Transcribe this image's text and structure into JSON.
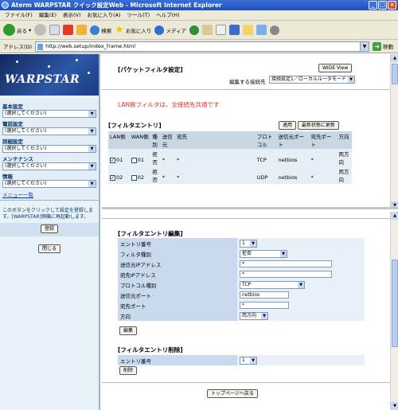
{
  "window": {
    "title": "Aterm WARPSTAR クイック設定Web - Microsoft Internet Explorer",
    "minimize": "_",
    "maximize": "□",
    "close": "×"
  },
  "menubar": [
    "ファイル(F)",
    "編集(E)",
    "表示(V)",
    "お気に入り(A)",
    "ツール(T)",
    "ヘルプ(H)"
  ],
  "toolbar": {
    "back": "戻る",
    "search": "検索",
    "favorites": "お気に入り",
    "media": "メディア"
  },
  "address": {
    "label": "アドレス(D)",
    "url": "http://web.setup/index_frame.html",
    "go": "移動"
  },
  "left": {
    "logo": "WARPSTAR",
    "sections": [
      {
        "label": "基本設定",
        "value": "(選択してください)"
      },
      {
        "label": "電話設定",
        "value": "(選択してください)"
      },
      {
        "label": "詳細設定",
        "value": "(選択してください)"
      },
      {
        "label": "メンテナンス",
        "value": "(選択してください)"
      },
      {
        "label": "情報",
        "value": "(選択してください)"
      }
    ],
    "menu_list": "メニュー一覧",
    "note": "このボタンをクリックして設定を登録します。[WARPSTAR]側機に再起動します。",
    "register": "登録",
    "close": "閉じる"
  },
  "upper": {
    "title": "[パケットフィルタ設定]",
    "wide_view": "WIDE View",
    "connection_label": "編集する接続先",
    "connection_value": "接続設定1／ローカルルータモード",
    "notice": "LAN側フィルタは、全接続先共通です",
    "entry_title": "[フィルタエントリ]",
    "apply": "適用",
    "refresh": "最新状態に更新",
    "columns": [
      "LAN側",
      "WAN側",
      "種別",
      "送信元",
      "宛先",
      "プロトコル",
      "送信元ポート",
      "宛先ポート",
      "方向"
    ],
    "rows": [
      {
        "lan": "01",
        "lan_checked": true,
        "wan": "01",
        "wan_checked": false,
        "type": "拒否",
        "src": "*",
        "dst": "*",
        "proto": "TCP",
        "sport": "netbios",
        "dport": "*",
        "dir": "両方向"
      },
      {
        "lan": "02",
        "lan_checked": true,
        "wan": "02",
        "wan_checked": false,
        "type": "拒否",
        "src": "*",
        "dst": "*",
        "proto": "UDP",
        "sport": "netbios",
        "dport": "*",
        "dir": "両方向"
      }
    ]
  },
  "lower": {
    "edit_title": "[フィルタエントリ編集]",
    "fields": {
      "entry_no": {
        "label": "エントリ番号",
        "value": "1"
      },
      "filter_type": {
        "label": "フィルタ種別",
        "value": "拒否"
      },
      "src_ip": {
        "label": "送信元IPアドレス",
        "value": "*"
      },
      "dst_ip": {
        "label": "宛先IPアドレス",
        "value": "*"
      },
      "protocol": {
        "label": "プロトコル種別",
        "value": "TCP"
      },
      "src_port": {
        "label": "送信元ポート",
        "value": "netbios"
      },
      "dst_port": {
        "label": "宛先ポート",
        "value": "*"
      },
      "direction": {
        "label": "方向",
        "value": "両方向"
      }
    },
    "edit_button": "編集",
    "delete_title": "[フィルタエントリ削除]",
    "delete_entry": {
      "label": "エントリ番号",
      "value": "1"
    },
    "delete_button": "削除",
    "top_link": "トップページへ戻る"
  }
}
